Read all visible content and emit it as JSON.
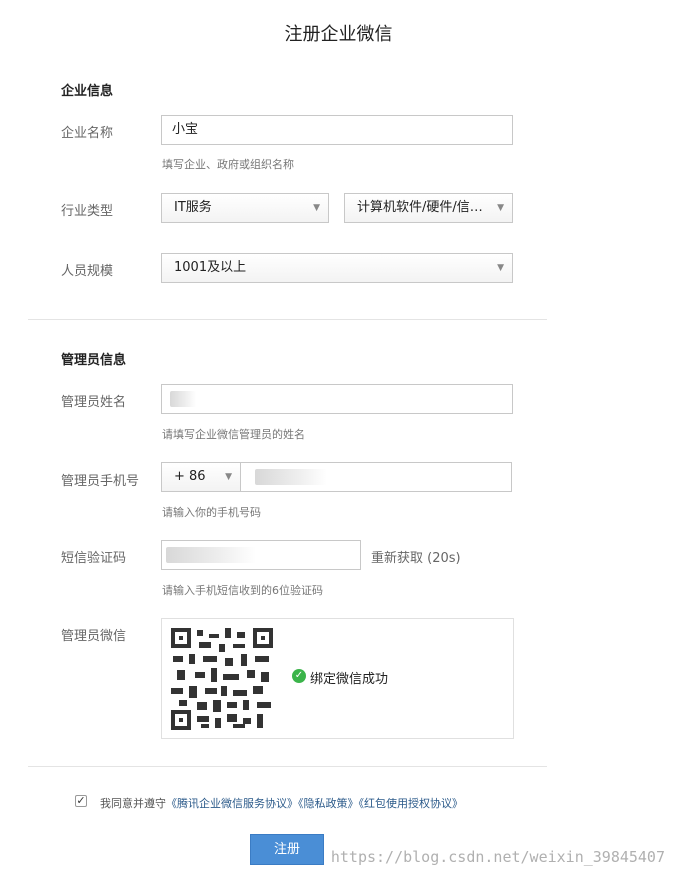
{
  "page": {
    "title": "注册企业微信"
  },
  "company_section": {
    "heading": "企业信息",
    "name_label": "企业名称",
    "name_value": "小宝",
    "name_hint": "填写企业、政府或组织名称",
    "industry_label": "行业类型",
    "industry_primary": "IT服务",
    "industry_secondary": "计算机软件/硬件/信…",
    "size_label": "人员规模",
    "size_value": "1001及以上"
  },
  "admin_section": {
    "heading": "管理员信息",
    "name_label": "管理员姓名",
    "name_hint": "请填写企业微信管理员的姓名",
    "phone_label": "管理员手机号",
    "country_code": "+ 86",
    "phone_hint": "请输入你的手机号码",
    "sms_label": "短信验证码",
    "resend_label": "重新获取 (20s)",
    "sms_hint": "请输入手机短信收到的6位验证码",
    "wechat_label": "管理员微信",
    "bind_status": "绑定微信成功"
  },
  "agreement": {
    "prefix": "我同意并遵守",
    "link1": "《腾讯企业微信服务协议》",
    "link2": "《隐私政策》",
    "link3": "《红包使用授权协议》"
  },
  "submit": {
    "label": "注册"
  },
  "watermark": "https://blog.csdn.net/weixin_39845407",
  "colors": {
    "primary_button": "#4a8ed6",
    "success": "#3bb44a",
    "link": "#2b5a8a"
  }
}
